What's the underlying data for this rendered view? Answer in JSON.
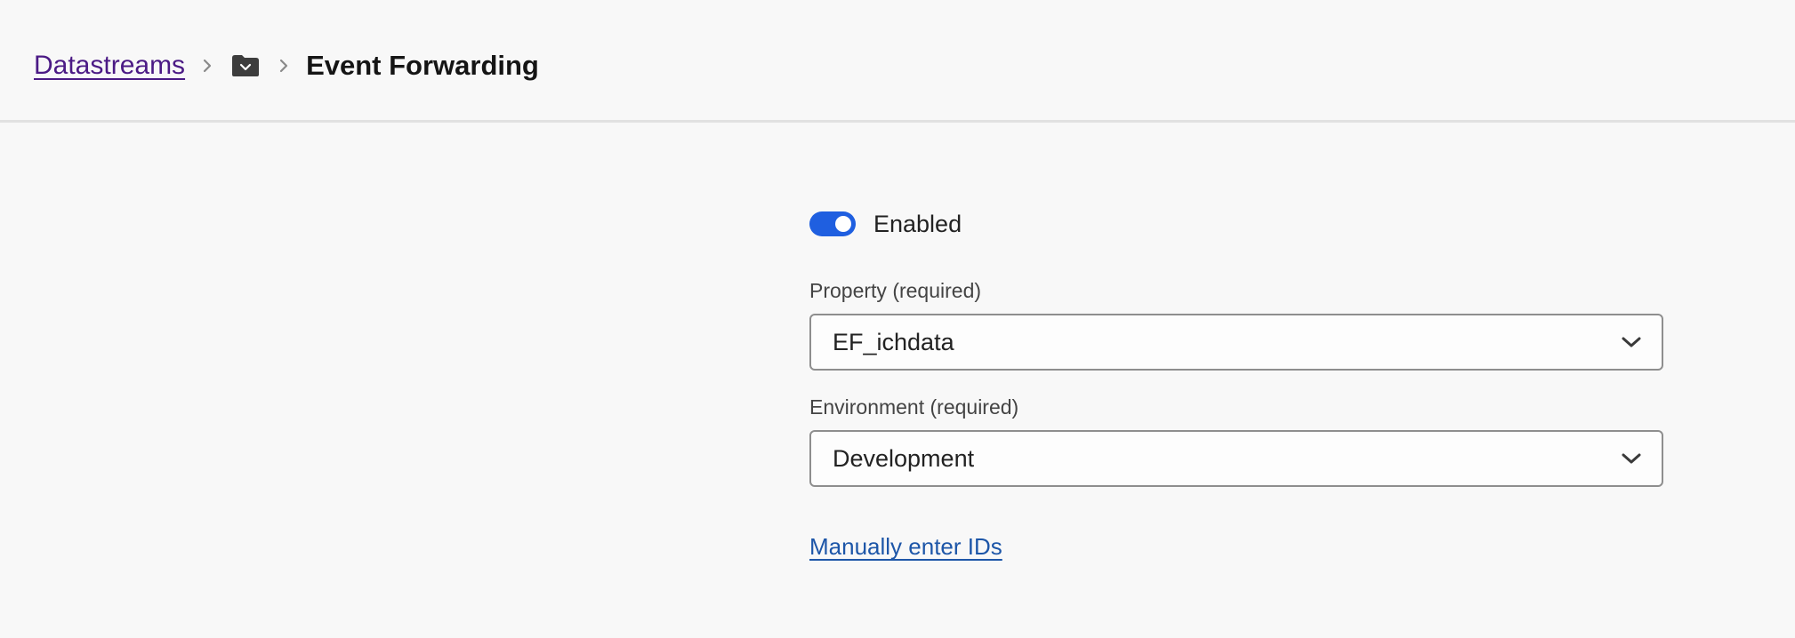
{
  "breadcrumb": {
    "root_label": "Datastreams",
    "folder_icon": "folder-icon",
    "current_label": "Event Forwarding"
  },
  "form": {
    "toggle": {
      "label": "Enabled",
      "state": "on"
    },
    "property": {
      "label": "Property (required)",
      "value": "EF_ichdata"
    },
    "environment": {
      "label": "Environment (required)",
      "value": "Development"
    },
    "manual_link": "Manually enter IDs"
  },
  "colors": {
    "toggle_on": "#1f5fe0",
    "breadcrumb_link": "#4b1a85",
    "action_link": "#1d56a8"
  }
}
